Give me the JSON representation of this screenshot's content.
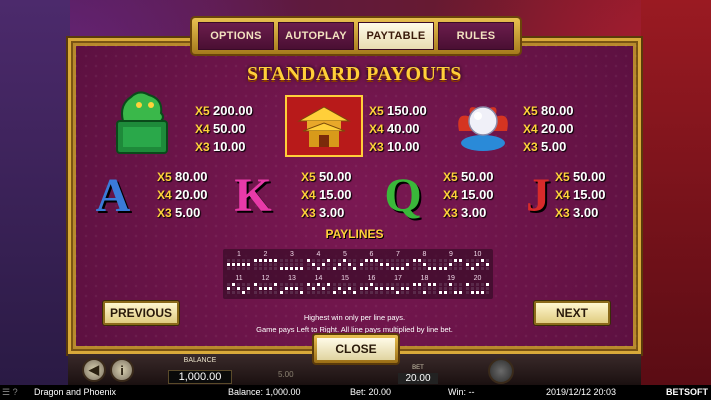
{
  "tabs": [
    "OPTIONS",
    "AUTOPLAY",
    "PAYTABLE",
    "RULES"
  ],
  "active_tab": "PAYTABLE",
  "title": "STANDARD PAYOUTS",
  "symbols": [
    {
      "name": "jade-dragon-seal",
      "payouts": [
        {
          "mul": "X5",
          "val": "200.00"
        },
        {
          "mul": "X4",
          "val": "50.00"
        },
        {
          "mul": "X3",
          "val": "10.00"
        }
      ]
    },
    {
      "name": "golden-pagoda",
      "payouts": [
        {
          "mul": "X5",
          "val": "150.00"
        },
        {
          "mul": "X4",
          "val": "40.00"
        },
        {
          "mul": "X3",
          "val": "10.00"
        }
      ]
    },
    {
      "name": "pearl-flame",
      "payouts": [
        {
          "mul": "X5",
          "val": "80.00"
        },
        {
          "mul": "X4",
          "val": "20.00"
        },
        {
          "mul": "X3",
          "val": "5.00"
        }
      ]
    },
    {
      "name": "A",
      "payouts": [
        {
          "mul": "X5",
          "val": "80.00"
        },
        {
          "mul": "X4",
          "val": "20.00"
        },
        {
          "mul": "X3",
          "val": "5.00"
        }
      ]
    },
    {
      "name": "K",
      "payouts": [
        {
          "mul": "X5",
          "val": "50.00"
        },
        {
          "mul": "X4",
          "val": "15.00"
        },
        {
          "mul": "X3",
          "val": "3.00"
        }
      ]
    },
    {
      "name": "Q",
      "payouts": [
        {
          "mul": "X5",
          "val": "50.00"
        },
        {
          "mul": "X4",
          "val": "15.00"
        },
        {
          "mul": "X3",
          "val": "3.00"
        }
      ]
    },
    {
      "name": "J",
      "payouts": [
        {
          "mul": "X5",
          "val": "50.00"
        },
        {
          "mul": "X4",
          "val": "15.00"
        },
        {
          "mul": "X3",
          "val": "3.00"
        }
      ]
    }
  ],
  "card_colors": {
    "A": "#3a7ad8",
    "K": "#e83aa8",
    "Q": "#3ab83a",
    "J": "#d82a2a"
  },
  "paylines_title": "PAYLINES",
  "paylines": [
    "1",
    "2",
    "3",
    "4",
    "5",
    "6",
    "7",
    "8",
    "9",
    "10",
    "11",
    "12",
    "13",
    "14",
    "15",
    "16",
    "17",
    "18",
    "19",
    "20"
  ],
  "buttons": {
    "previous": "PREVIOUS",
    "next": "NEXT",
    "close": "CLOSE"
  },
  "notes": {
    "line1": "Highest win only per line pays.",
    "line2": "Game pays Left to Right. All line pays multiplied by line bet."
  },
  "controls": {
    "balance_label": "BALANCE",
    "balance_value": "1,000.00",
    "info_icon": "i",
    "sound_icon": "speaker-icon",
    "dim_value": "5.00",
    "bet_label": "BET",
    "bet_value": "20.00"
  },
  "status_bar": {
    "game": "Dragon and Phoenix",
    "balance": "Balance: 1,000.00",
    "bet": "Bet: 20.00",
    "win": "Win: --",
    "datetime": "2019/12/12 20:03",
    "brand": "BETSOFT"
  }
}
